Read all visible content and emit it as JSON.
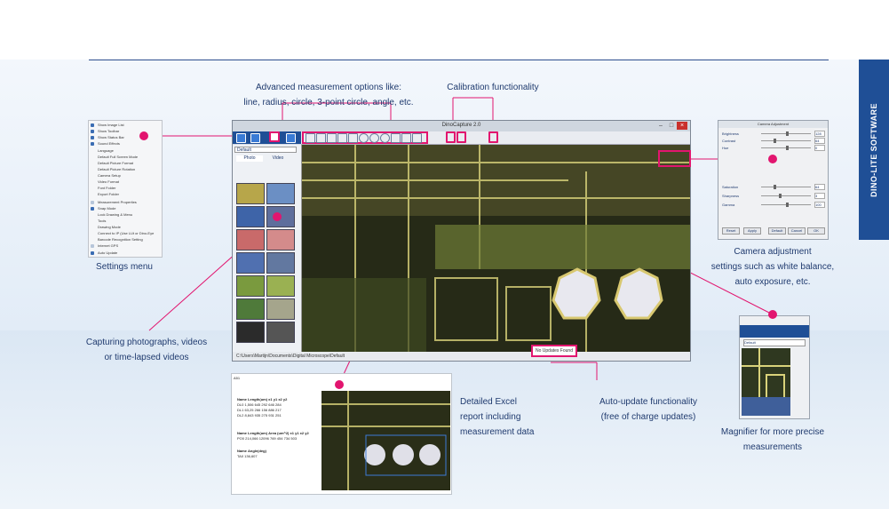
{
  "brand": {
    "side_tab": "DINO-LITE SOFTWARE",
    "accent": "#e2156f",
    "navy": "#1f4f96"
  },
  "app": {
    "title": "DinoCapture 2.0",
    "status_path": "C:\\Users\\Martijn\\Documents\\Digital Microscope\\Default",
    "update_badge": "No Updates Found",
    "folder": "Default",
    "tab_photo": "Photo",
    "tab_video": "Video"
  },
  "callouts": {
    "measurement": {
      "line1": "Advanced measurement options like:",
      "line2": "line, radius, circle, 3-point circle, angle, etc."
    },
    "calibration": {
      "text": "Calibration functionality"
    },
    "settings": {
      "text": "Settings menu"
    },
    "capture": {
      "line1": "Capturing photographs, videos",
      "line2": "or time-lapsed videos"
    },
    "camera": {
      "line1": "Camera adjustment",
      "line2": "settings such as white balance,",
      "line3": "auto exposure, etc."
    },
    "excel": {
      "line1": "Detailed Excel",
      "line2": "report including",
      "line3": "measurement data"
    },
    "autoupdate": {
      "line1": "Auto-update functionality",
      "line2": "(free of charge updates)"
    },
    "magnifier": {
      "line1": "Magnifier for more precise",
      "line2": "measurements"
    }
  },
  "settings_menu": {
    "items": [
      "Show Image List",
      "Show Toolbar",
      "Show Status Bar",
      "Sound Effects",
      "Language",
      "Default Full Screen Mode",
      "Default Picture Format",
      "Default Picture Rotation",
      "Camera Setup",
      "Video Format",
      "Font Folder",
      "Export Folder",
      "Measurement Properties",
      "Snap Mode",
      "Lock Drawing & Menu",
      "Tools",
      "Drawing Mode",
      "Connect to IP (Use LUt or Dino-Eye",
      "Barcode Recognition Setting",
      "Internet GPS",
      "Auto Update"
    ]
  },
  "camera_adjust": {
    "title": "Camera Adjustment",
    "sliders": [
      "Brightness",
      "Contrast",
      "Hue",
      "Saturation",
      "Sharpness",
      "Gamma"
    ],
    "values": [
      "128",
      "64",
      "0",
      "64",
      "3",
      "100"
    ],
    "buttons": [
      "Reset",
      "Apply",
      "Default",
      "Cancel",
      "OK"
    ]
  },
  "excel": {
    "cell_ref": "A51",
    "table1": {
      "headers": [
        "Name",
        "Length(um)",
        "x1",
        "y1",
        "x2",
        "y2"
      ],
      "rows": [
        [
          "DL0",
          "1,506",
          "645",
          "292",
          "646",
          "284"
        ],
        [
          "DL1",
          "63,25",
          "266",
          "156",
          "886",
          "217"
        ],
        [
          "DL2",
          "8,843",
          "935",
          "275",
          "931",
          "251"
        ]
      ]
    },
    "table2": {
      "headers": [
        "Name",
        "Length(um)",
        "Area (um^2)",
        "x1",
        "y1",
        "x2",
        "y2"
      ],
      "rows": [
        [
          "PO0",
          "214,066",
          "12096",
          "769",
          "454",
          "734",
          "503"
        ]
      ]
    },
    "table3": {
      "headers": [
        "Name",
        "Angle(deg)"
      ],
      "rows": [
        [
          "TA0",
          "136,607"
        ]
      ]
    }
  },
  "magnifier": {
    "folder": "Default"
  }
}
